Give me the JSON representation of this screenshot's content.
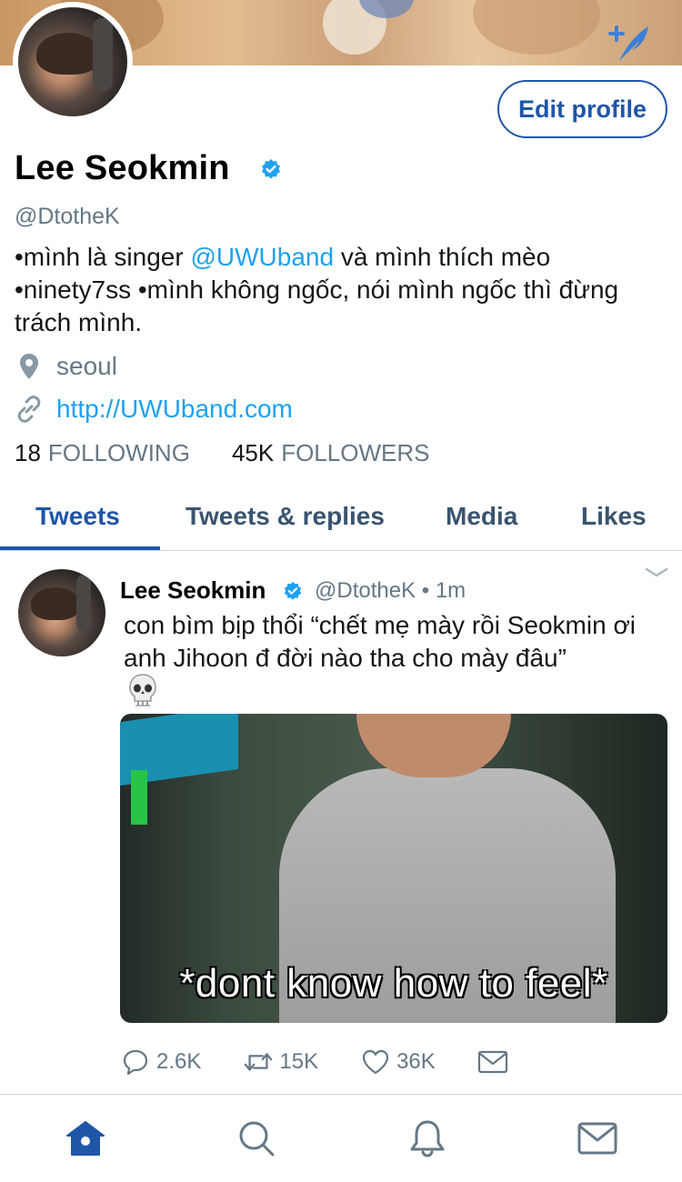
{
  "header": {
    "back_icon": "chevron-left-icon",
    "compose_icon": "compose-tweet-icon",
    "edit_profile_label": "Edit profile"
  },
  "profile": {
    "display_name": "Lee Seokmin",
    "handle": "@DtotheK",
    "bio": {
      "part1": "•mình là singer ",
      "mention": "@UWUband",
      "part2": " và mình thích mèo •ninety7ss •mình không ngốc, nói mình ngốc thì đừng trách mình."
    },
    "location": "seoul",
    "url": "http://UWUband.com",
    "following_count": "18",
    "following_label": "FOLLOWING",
    "followers_count": "45K",
    "followers_label": "FOLLOWERS"
  },
  "tabs": [
    {
      "label": "Tweets",
      "active": true
    },
    {
      "label": "Tweets & replies",
      "active": false
    },
    {
      "label": "Media",
      "active": false
    },
    {
      "label": "Likes",
      "active": false
    }
  ],
  "tweet": {
    "name": "Lee Seokmin",
    "handle_time": "@DtotheK • 1m",
    "text": "con bìm bịp thổi “chết mẹ mày rồi Seokmin ơi anh Jihoon đ đời nào tha cho mày đâu”",
    "emoji": "skull-emoji",
    "media_caption": "*dont know how to feel*",
    "replies": "2.6K",
    "retweets": "15K",
    "likes": "36K"
  },
  "bottom_nav": [
    "home-icon",
    "search-icon",
    "notifications-icon",
    "messages-icon"
  ],
  "colors": {
    "accent": "#1f56a8",
    "link": "#1da1f2",
    "muted": "#657786",
    "verified": "#1da1f2"
  }
}
